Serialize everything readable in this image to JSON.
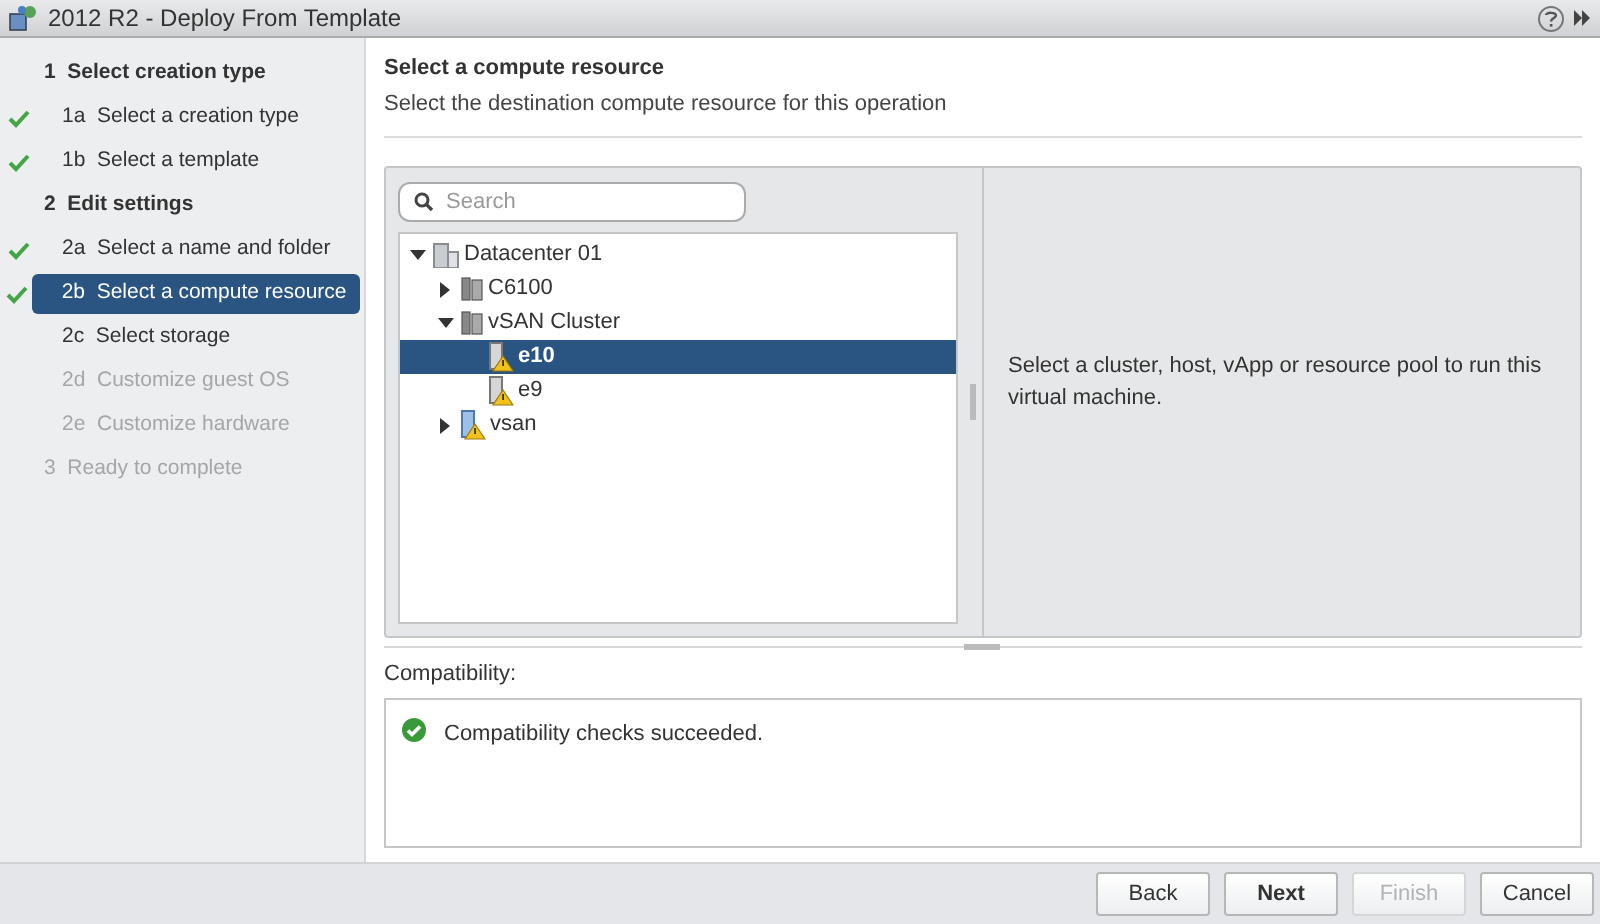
{
  "window": {
    "title": "2012 R2 - Deploy From Template"
  },
  "steps": [
    {
      "kind": "header",
      "label": "1  Select creation type",
      "done": false,
      "selected": false,
      "disabled": false
    },
    {
      "kind": "item",
      "label": "1a  Select a creation type",
      "done": true,
      "selected": false,
      "disabled": false
    },
    {
      "kind": "item",
      "label": "1b  Select a template",
      "done": true,
      "selected": false,
      "disabled": false
    },
    {
      "kind": "header",
      "label": "2  Edit settings",
      "done": false,
      "selected": false,
      "disabled": false
    },
    {
      "kind": "item",
      "label": "2a  Select a name and folder",
      "done": true,
      "selected": false,
      "disabled": false
    },
    {
      "kind": "item",
      "label": "2b  Select a compute resource",
      "done": true,
      "selected": true,
      "disabled": false
    },
    {
      "kind": "item",
      "label": "2c  Select storage",
      "done": false,
      "selected": false,
      "disabled": false
    },
    {
      "kind": "item",
      "label": "2d  Customize guest OS",
      "done": false,
      "selected": false,
      "disabled": true
    },
    {
      "kind": "item",
      "label": "2e  Customize hardware",
      "done": false,
      "selected": false,
      "disabled": true
    },
    {
      "kind": "header",
      "label": "3  Ready to complete",
      "done": false,
      "selected": false,
      "disabled": true
    }
  ],
  "page": {
    "title": "Select a compute resource",
    "subtitle": "Select the destination compute resource for this operation"
  },
  "search": {
    "placeholder": "Search"
  },
  "tree": [
    {
      "label": "Datacenter 01",
      "kind": "datacenter",
      "expanded": true,
      "selected": false,
      "children": [
        {
          "label": "C6100",
          "kind": "cluster",
          "expanded": false,
          "selected": false
        },
        {
          "label": "vSAN Cluster",
          "kind": "cluster",
          "expanded": true,
          "selected": false,
          "children": [
            {
              "label": "e10",
              "kind": "host",
              "selected": true
            },
            {
              "label": "e9",
              "kind": "host",
              "selected": false
            }
          ]
        },
        {
          "label": "vsan",
          "kind": "vhost",
          "expanded": false,
          "selected": false
        }
      ]
    }
  ],
  "description": "Select a cluster, host, vApp or resource pool to run this virtual machine.",
  "compatibility": {
    "label": "Compatibility:",
    "message": "Compatibility checks succeeded."
  },
  "buttons": [
    {
      "label": "Back",
      "disabled": false,
      "primary": false
    },
    {
      "label": "Next",
      "disabled": false,
      "primary": true
    },
    {
      "label": "Finish",
      "disabled": true,
      "primary": false
    },
    {
      "label": "Cancel",
      "disabled": false,
      "primary": false
    }
  ]
}
